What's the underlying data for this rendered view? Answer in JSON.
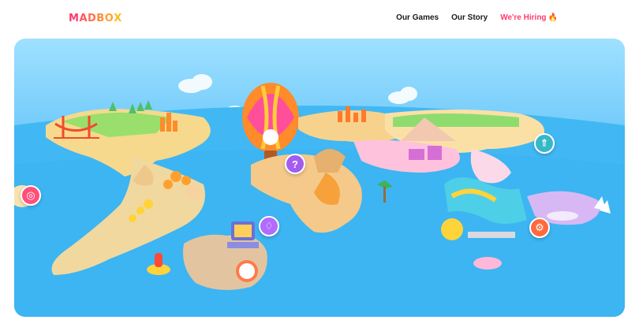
{
  "brand": {
    "logo_letters": [
      "M",
      "A",
      "D",
      "B",
      "O",
      "X"
    ],
    "logo_colors": [
      "#ff3b6a",
      "#ff5566",
      "#ff6f4f",
      "#ff8a3a",
      "#ffa22b",
      "#ffb91f"
    ]
  },
  "nav": {
    "items": [
      {
        "label": "Our Games"
      },
      {
        "label": "Our Story"
      },
      {
        "label": "We're Hiring",
        "emoji": "🔥"
      }
    ]
  },
  "map": {
    "markers": [
      {
        "name": "brain-marker",
        "icon": "brain-icon",
        "glyph": "◎",
        "color": "#ff4f7b"
      },
      {
        "name": "question-marker",
        "icon": "question-icon",
        "glyph": "?",
        "color": "#a35cf0"
      },
      {
        "name": "lightbulb-marker",
        "icon": "lightbulb-icon",
        "glyph": "♢",
        "color": "#b06bff"
      },
      {
        "name": "rocket-marker",
        "icon": "rocket-icon",
        "glyph": "⇑",
        "color": "#36b8c9"
      },
      {
        "name": "gear-marker",
        "icon": "gear-icon",
        "glyph": "⚙",
        "color": "#ff6a3d"
      }
    ]
  }
}
